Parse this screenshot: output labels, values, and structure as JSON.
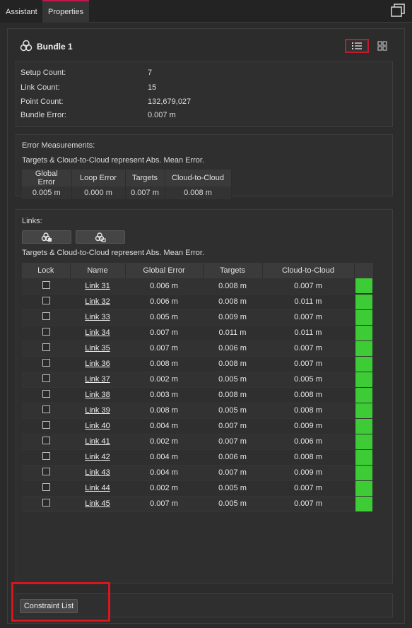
{
  "tabs": {
    "assistant": "Assistant",
    "properties": "Properties"
  },
  "header": {
    "title": "Bundle 1",
    "icon": "bundle-icon"
  },
  "info": [
    {
      "label": "Setup Count:",
      "value": "7"
    },
    {
      "label": "Link Count:",
      "value": "15"
    },
    {
      "label": "Point Count:",
      "value": "132,679,027"
    },
    {
      "label": "Bundle Error:",
      "value": "0.007 m"
    }
  ],
  "error_measurements": {
    "heading": "Error Measurements:",
    "note": "Targets & Cloud-to-Cloud represent Abs. Mean Error.",
    "columns": [
      "Global Error",
      "Loop Error",
      "Targets",
      "Cloud-to-Cloud"
    ],
    "values": [
      "0.005 m",
      "0.000 m",
      "0.007 m",
      "0.008 m"
    ]
  },
  "links": {
    "heading": "Links:",
    "note": "Targets & Cloud-to-Cloud represent Abs. Mean Error.",
    "columns": [
      "Lock",
      "Name",
      "Global Error",
      "Targets",
      "Cloud-to-Cloud",
      ""
    ],
    "status_color": "#3ecc36",
    "rows": [
      {
        "name": "Link 31",
        "global": "0.006 m",
        "targets": "0.008 m",
        "c2c": "0.007 m"
      },
      {
        "name": "Link 32",
        "global": "0.006 m",
        "targets": "0.008 m",
        "c2c": "0.011 m"
      },
      {
        "name": "Link 33",
        "global": "0.005 m",
        "targets": "0.009 m",
        "c2c": "0.007 m"
      },
      {
        "name": "Link 34",
        "global": "0.007 m",
        "targets": "0.011 m",
        "c2c": "0.011 m"
      },
      {
        "name": "Link 35",
        "global": "0.007 m",
        "targets": "0.006 m",
        "c2c": "0.007 m"
      },
      {
        "name": "Link 36",
        "global": "0.008 m",
        "targets": "0.008 m",
        "c2c": "0.007 m"
      },
      {
        "name": "Link 37",
        "global": "0.002 m",
        "targets": "0.005 m",
        "c2c": "0.005 m"
      },
      {
        "name": "Link 38",
        "global": "0.003 m",
        "targets": "0.008 m",
        "c2c": "0.008 m"
      },
      {
        "name": "Link 39",
        "global": "0.008 m",
        "targets": "0.005 m",
        "c2c": "0.008 m"
      },
      {
        "name": "Link 40",
        "global": "0.004 m",
        "targets": "0.007 m",
        "c2c": "0.009 m"
      },
      {
        "name": "Link 41",
        "global": "0.002 m",
        "targets": "0.007 m",
        "c2c": "0.006 m"
      },
      {
        "name": "Link 42",
        "global": "0.004 m",
        "targets": "0.006 m",
        "c2c": "0.008 m"
      },
      {
        "name": "Link 43",
        "global": "0.004 m",
        "targets": "0.007 m",
        "c2c": "0.009 m"
      },
      {
        "name": "Link 44",
        "global": "0.002 m",
        "targets": "0.005 m",
        "c2c": "0.007 m"
      },
      {
        "name": "Link 45",
        "global": "0.007 m",
        "targets": "0.005 m",
        "c2c": "0.007 m"
      }
    ]
  },
  "footer": {
    "constraint_button": "Constraint List"
  },
  "colors": {
    "highlight": "#d6171f",
    "accent_tab": "#c0174a"
  }
}
